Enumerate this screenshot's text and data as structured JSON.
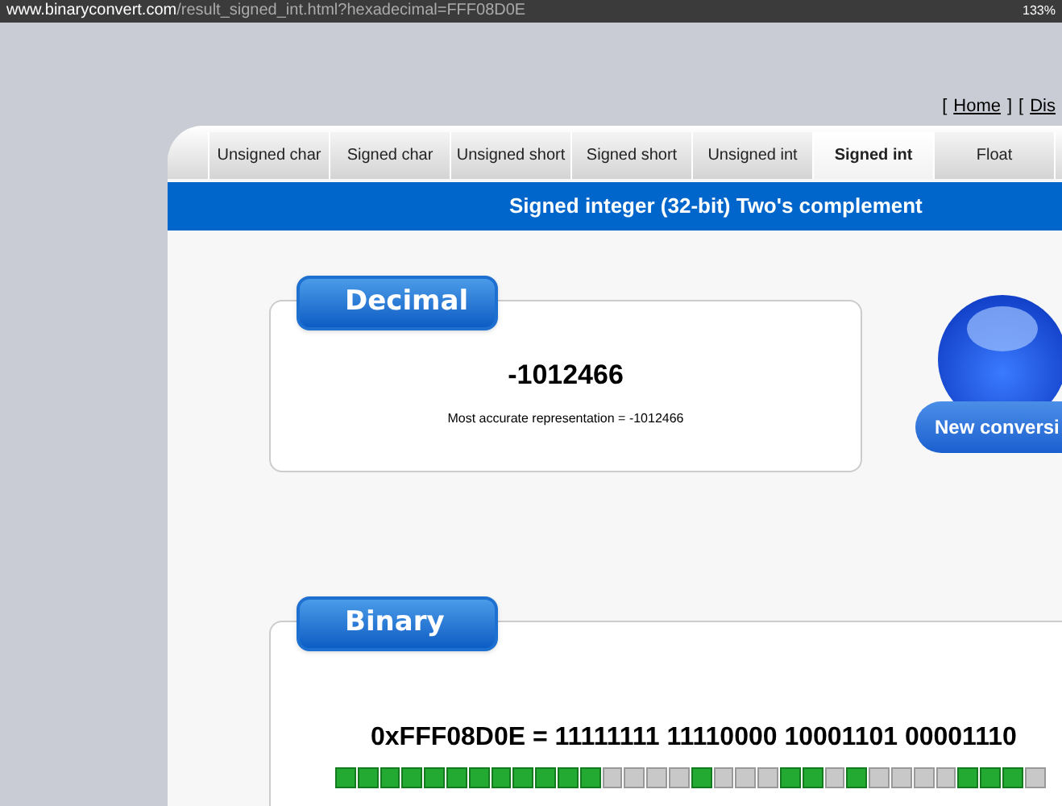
{
  "browser": {
    "url_domain": "www.binaryconvert.com",
    "url_path": "/result_signed_int.html?hexadecimal=FFF08D0E",
    "zoom": "133%"
  },
  "top_links": [
    {
      "open": "[",
      "label": "Home",
      "close": "]"
    },
    {
      "open": "[",
      "label": "Dis"
    }
  ],
  "tabs": [
    {
      "label": "Unsigned char",
      "selected": false
    },
    {
      "label": "Signed char",
      "selected": false
    },
    {
      "label": "Unsigned short",
      "selected": false
    },
    {
      "label": "Signed short",
      "selected": false
    },
    {
      "label": "Unsigned int",
      "selected": false
    },
    {
      "label": "Signed int",
      "selected": true
    },
    {
      "label": "Float",
      "selected": false
    }
  ],
  "banner": "Signed integer (32-bit) Two's complement",
  "decimal": {
    "label": "Decimal",
    "value": "-1012466",
    "note": "Most accurate representation = -1012466"
  },
  "new_conversion": "New conversi",
  "binary": {
    "label": "Binary",
    "expression": "0xFFF08D0E = 11111111 11110000 10001101 00001110",
    "bits": [
      {
        "on": true
      },
      {
        "on": true
      },
      {
        "on": true
      },
      {
        "on": true
      },
      {
        "on": true
      },
      {
        "on": true
      },
      {
        "on": true
      },
      {
        "on": true
      },
      {
        "on": true
      },
      {
        "on": true
      },
      {
        "on": true
      },
      {
        "on": true
      },
      {
        "on": false
      },
      {
        "on": false
      },
      {
        "on": false
      },
      {
        "on": false
      },
      {
        "on": true
      },
      {
        "on": false
      },
      {
        "on": false
      },
      {
        "on": false
      },
      {
        "on": true
      },
      {
        "on": true
      },
      {
        "on": false
      },
      {
        "on": true
      },
      {
        "on": false
      },
      {
        "on": false
      },
      {
        "on": false
      },
      {
        "on": false
      },
      {
        "on": true
      },
      {
        "on": true
      },
      {
        "on": true
      },
      {
        "on": false
      }
    ]
  }
}
